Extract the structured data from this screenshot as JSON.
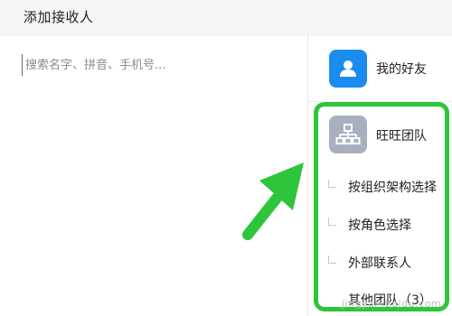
{
  "header": {
    "title": "添加接收人"
  },
  "search": {
    "placeholder": "搜索名字、拼音、手机号..."
  },
  "sidebar": {
    "friends": {
      "label": "我的好友",
      "icon": "user-icon",
      "icon_color": "#1a8cf0"
    },
    "team": {
      "label": "旺旺团队",
      "icon": "org-chart-icon",
      "icon_color": "#a8b0c0",
      "options": [
        "按组织架构选择",
        "按角色选择",
        "外部联系人",
        "其他团队（3）"
      ]
    }
  },
  "annotation": {
    "highlight_color": "#2ec53a",
    "watermark": "jingyan.baidu.com"
  }
}
